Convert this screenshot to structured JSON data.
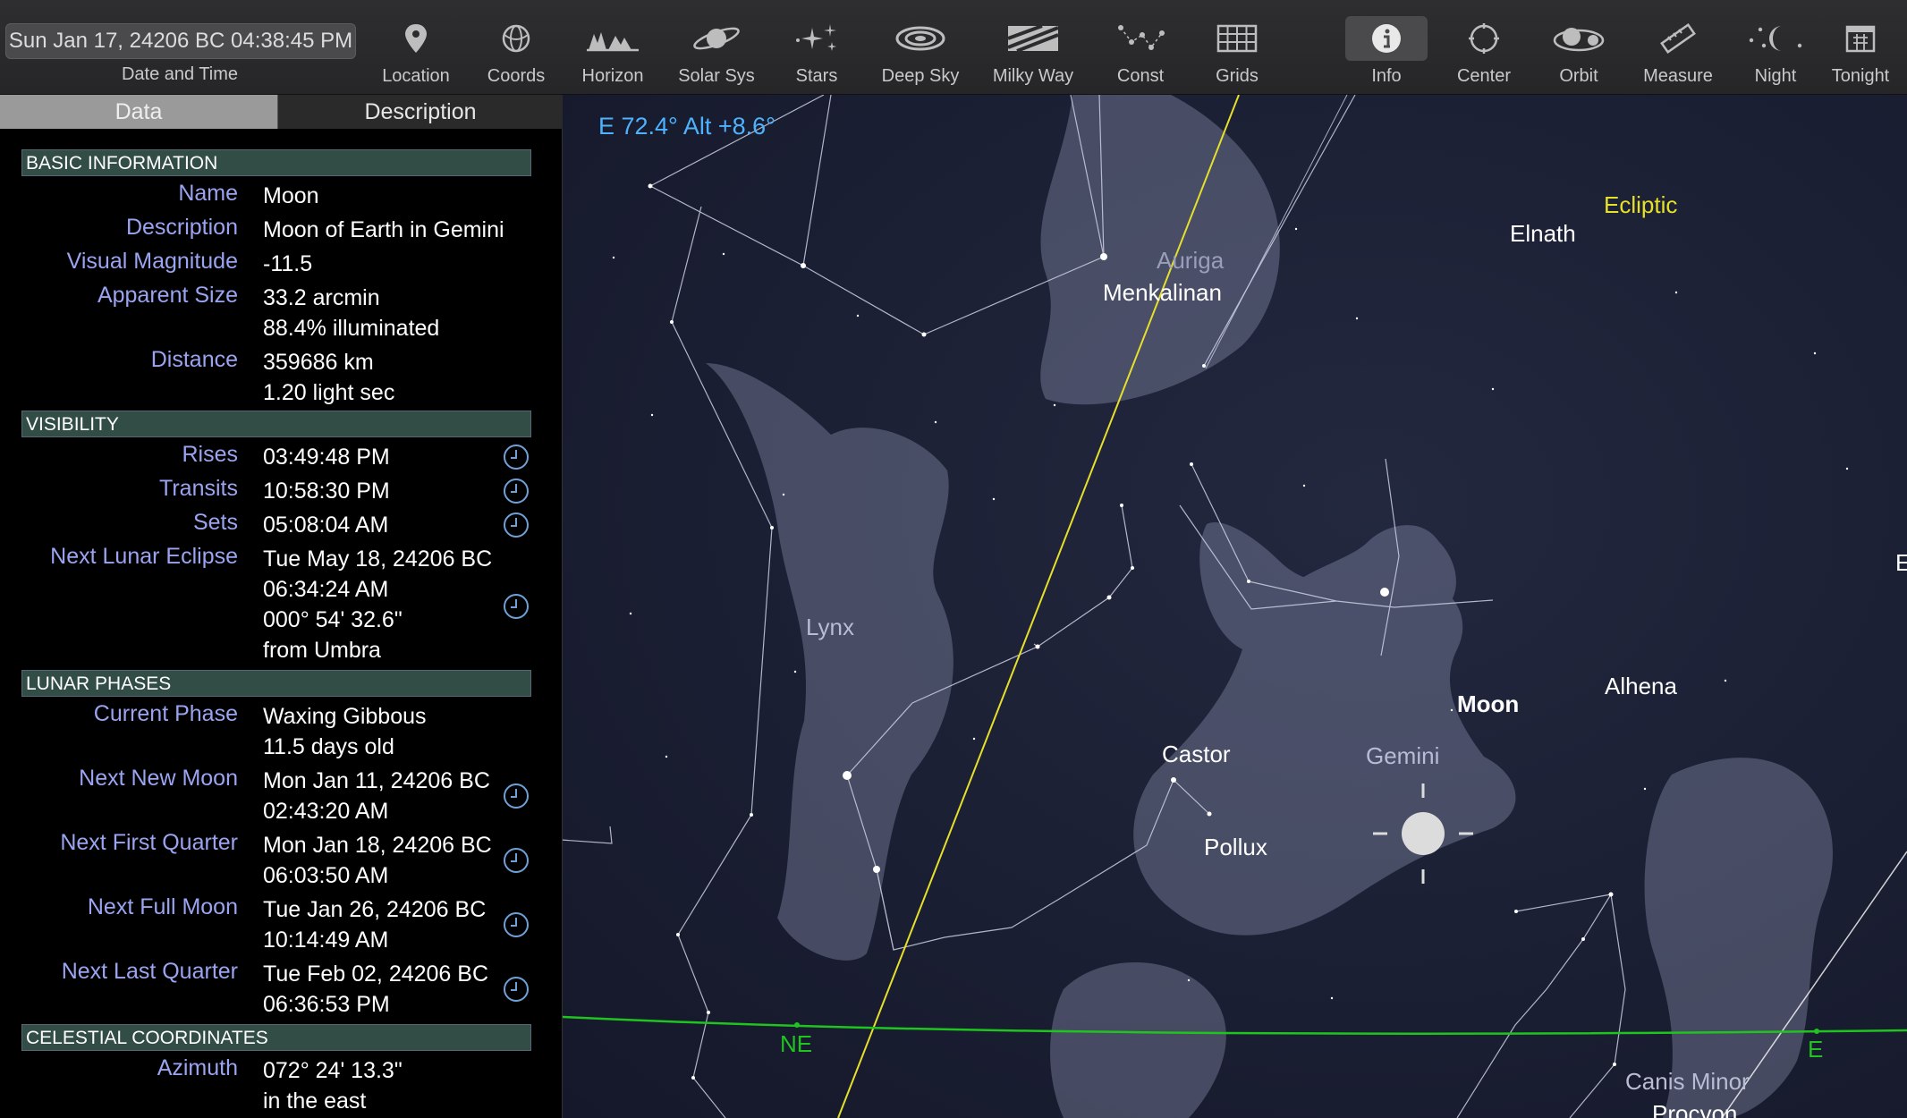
{
  "toolbar": {
    "datetime": "Sun Jan 17, 24206 BC 04:38:45 PM",
    "datetime_label": "Date and Time",
    "items": [
      {
        "label": "Location",
        "icon": "location-pin-icon"
      },
      {
        "label": "Coords",
        "icon": "coords-icon"
      },
      {
        "label": "Horizon",
        "icon": "horizon-icon"
      },
      {
        "label": "Solar Sys",
        "icon": "solar-system-icon"
      },
      {
        "label": "Stars",
        "icon": "stars-icon"
      },
      {
        "label": "Deep Sky",
        "icon": "galaxy-icon"
      },
      {
        "label": "Milky Way",
        "icon": "milky-way-icon"
      },
      {
        "label": "Const",
        "icon": "constellation-icon"
      },
      {
        "label": "Grids",
        "icon": "grid-icon"
      },
      {
        "label": "Info",
        "icon": "info-icon"
      },
      {
        "label": "Center",
        "icon": "center-icon"
      },
      {
        "label": "Orbit",
        "icon": "orbit-icon"
      },
      {
        "label": "Measure",
        "icon": "ruler-icon"
      },
      {
        "label": "Night",
        "icon": "night-moon-icon"
      },
      {
        "label": "Tonight",
        "icon": "calendar-icon"
      }
    ]
  },
  "panel": {
    "tabs": {
      "data": "Data",
      "description": "Description"
    },
    "sections": {
      "basic": "BASIC INFORMATION",
      "visibility": "VISIBILITY",
      "phases": "LUNAR PHASES",
      "coords": "CELESTIAL COORDINATES"
    },
    "basic": {
      "name_k": "Name",
      "name_v": "Moon",
      "desc_k": "Description",
      "desc_v": "Moon of Earth in Gemini",
      "mag_k": "Visual Magnitude",
      "mag_v": "-11.5",
      "size_k": "Apparent Size",
      "size_v1": "33.2 arcmin",
      "size_v2": "88.4% illuminated",
      "dist_k": "Distance",
      "dist_v1": "359686 km",
      "dist_v2": "1.20 light sec"
    },
    "visibility": {
      "rises_k": "Rises",
      "rises_v": "03:49:48 PM",
      "transits_k": "Transits",
      "transits_v": "10:58:30 PM",
      "sets_k": "Sets",
      "sets_v": "05:08:04 AM",
      "eclipse_k": "Next Lunar Eclipse",
      "eclipse_v1": "Tue May 18, 24206 BC",
      "eclipse_v2": "06:34:24 AM",
      "eclipse_v3": "000° 54' 32.6\"",
      "eclipse_v4": "from Umbra"
    },
    "phases": {
      "cur_k": "Current Phase",
      "cur_v1": "Waxing Gibbous",
      "cur_v2": "11.5 days old",
      "new_k": "Next New Moon",
      "new_v1": "Mon Jan 11, 24206 BC",
      "new_v2": "02:43:20 AM",
      "first_k": "Next First Quarter",
      "first_v1": "Mon Jan 18, 24206 BC",
      "first_v2": "06:03:50 AM",
      "full_k": "Next Full Moon",
      "full_v1": "Tue Jan 26, 24206 BC",
      "full_v2": "10:14:49 AM",
      "last_k": "Next Last Quarter",
      "last_v1": "Tue Feb 02, 24206 BC",
      "last_v2": "06:36:53 PM"
    },
    "coords": {
      "az_k": "Azimuth",
      "az_v1": "072° 24' 13.3\"",
      "az_v2": "in the east"
    }
  },
  "sky": {
    "altaz": "E 72.4° Alt +8.6°",
    "ecliptic_label": "Ecliptic",
    "ecliptic_color": "#e6e02a",
    "horizon_color": "#1fc41f",
    "labels": {
      "auriga": "Auriga",
      "menkalinan": "Menkalinan",
      "elnath": "Elnath",
      "lynx": "Lynx",
      "moon": "Moon",
      "gemini": "Gemini",
      "castor": "Castor",
      "pollux": "Pollux",
      "alhena": "Alhena",
      "ne": "NE",
      "e": "E",
      "canis_minor": "Canis Minor",
      "procyon": "Procyon",
      "edge_e": "E"
    }
  }
}
